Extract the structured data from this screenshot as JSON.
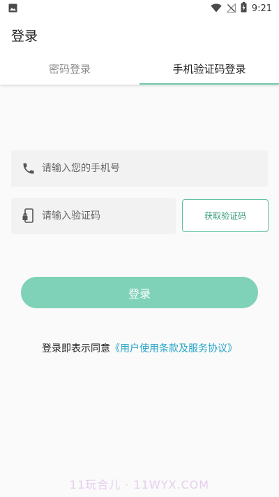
{
  "status_bar": {
    "time": "9:21",
    "icons": [
      "image-notification-icon",
      "wifi-icon",
      "no-signal-icon",
      "battery-charging-icon"
    ]
  },
  "header": {
    "title": "登录"
  },
  "tabs": [
    {
      "label": "密码登录",
      "active": false
    },
    {
      "label": "手机验证码登录",
      "active": true
    }
  ],
  "form": {
    "phone_placeholder": "请输入您的手机号",
    "code_placeholder": "请输入验证码",
    "get_code_label": "获取验证码",
    "login_label": "登录"
  },
  "agreement": {
    "prefix": "登录即表示同意",
    "link": "《用户使用条款及服务协议》"
  },
  "watermark": "11玩合儿 · 11WYX.COM",
  "colors": {
    "accent": "#7fd1b7",
    "accent_border": "#5fbf9f",
    "link": "#25a3c8"
  }
}
